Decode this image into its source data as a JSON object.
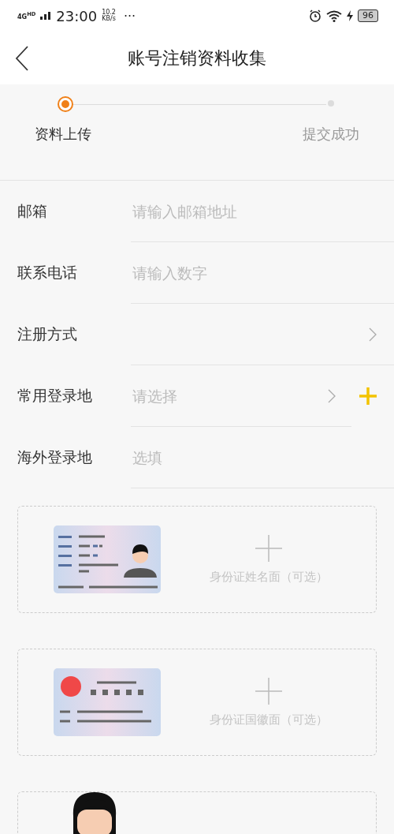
{
  "status_bar": {
    "network": "4G",
    "network_sup": "HD",
    "time": "23:00",
    "speed": "10.2",
    "speed_unit": "KB/s",
    "more": "···",
    "battery": "96"
  },
  "header": {
    "title": "账号注销资料收集"
  },
  "steps": [
    {
      "label": "资料上传",
      "selected": true
    },
    {
      "label": "提交成功",
      "selected": false
    }
  ],
  "form": [
    {
      "label": "邮箱",
      "placeholder": "请输入邮箱地址",
      "chevron": false,
      "add_button": false
    },
    {
      "label": "联系电话",
      "placeholder": "请输入数字",
      "chevron": false,
      "add_button": false
    },
    {
      "label": "注册方式",
      "chevron": true,
      "add_button": false
    },
    {
      "label": "常用登录地",
      "placeholder": "请选择",
      "chevron": true,
      "add_button": true
    },
    {
      "label": "海外登录地",
      "placeholder": "选填",
      "chevron": false,
      "add_button": false
    }
  ],
  "uploads": [
    {
      "kind": "id_front",
      "label": "身份证姓名面（可选）"
    },
    {
      "kind": "id_back",
      "label": "身份证国徽面（可选）"
    },
    {
      "kind": "portrait"
    }
  ]
}
